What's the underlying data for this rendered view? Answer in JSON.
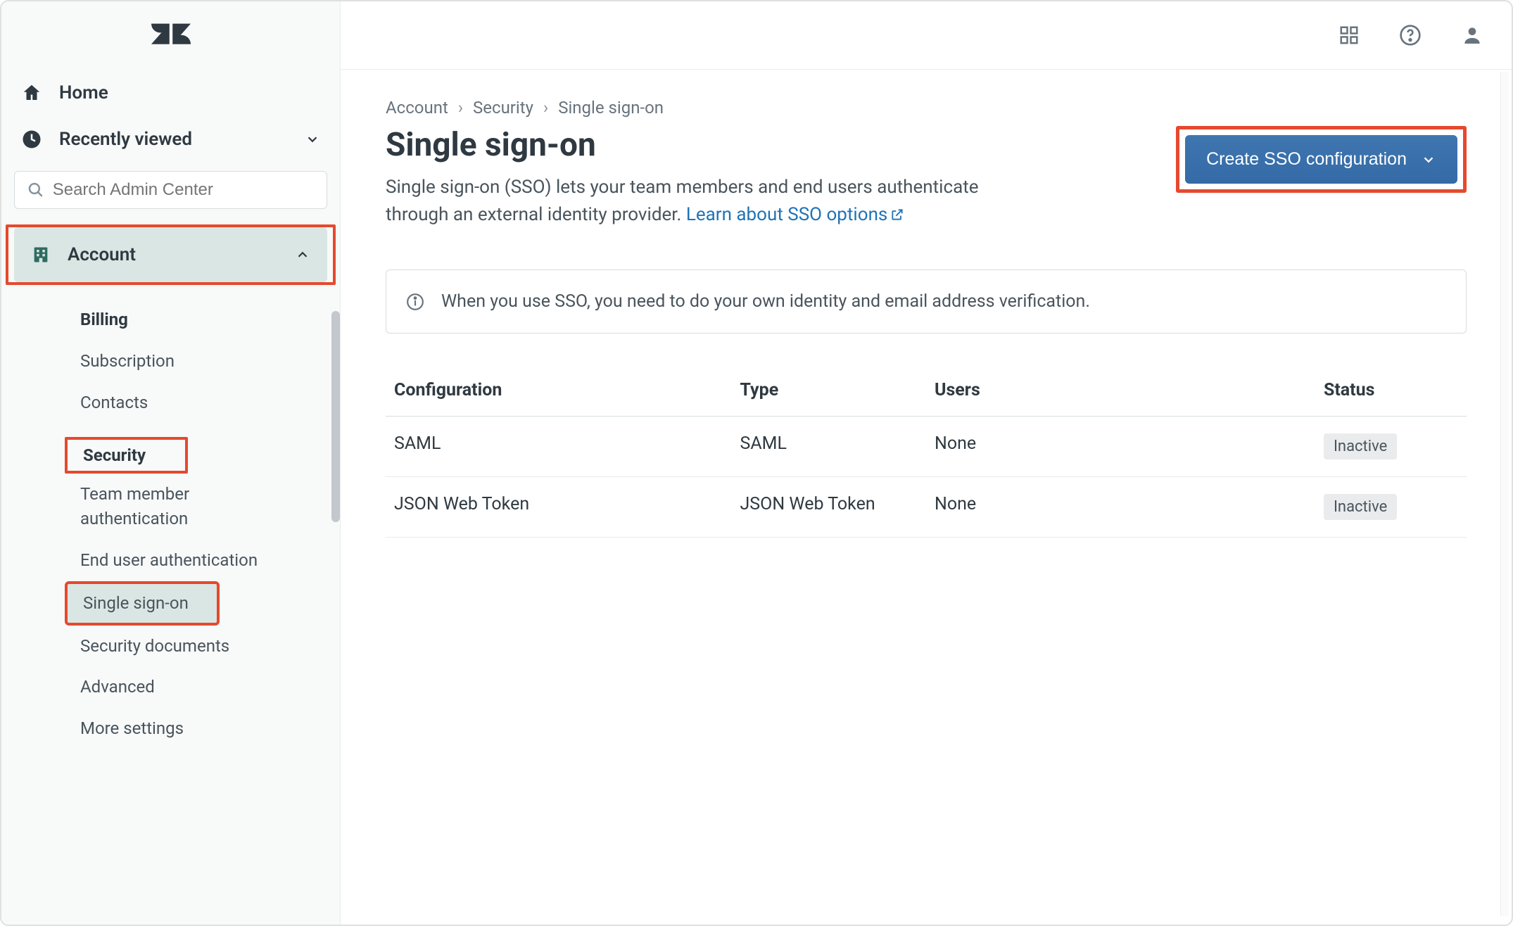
{
  "sidebar": {
    "home": "Home",
    "recently_viewed": "Recently viewed",
    "search_placeholder": "Search Admin Center",
    "section": {
      "label": "Account",
      "items_primary": [
        "Billing",
        "Subscription",
        "Contacts"
      ],
      "security_heading": "Security",
      "items_security": [
        "Team member authentication",
        "End user authentication",
        "Single sign-on",
        "Security documents",
        "Advanced",
        "More settings"
      ]
    }
  },
  "breadcrumb": [
    "Account",
    "Security",
    "Single sign-on"
  ],
  "page": {
    "title": "Single sign-on",
    "description_pre": "Single sign-on (SSO) lets your team members and end users authenticate through an external identity provider. ",
    "link_text": "Learn about SSO options",
    "cta_label": "Create SSO configuration"
  },
  "banner": "When you use SSO, you need to do your own identity and email address verification.",
  "table": {
    "headers": [
      "Configuration",
      "Type",
      "Users",
      "Status"
    ],
    "rows": [
      {
        "config": "SAML",
        "type": "SAML",
        "users": "None",
        "status": "Inactive"
      },
      {
        "config": "JSON Web Token",
        "type": "JSON Web Token",
        "users": "None",
        "status": "Inactive"
      }
    ]
  }
}
